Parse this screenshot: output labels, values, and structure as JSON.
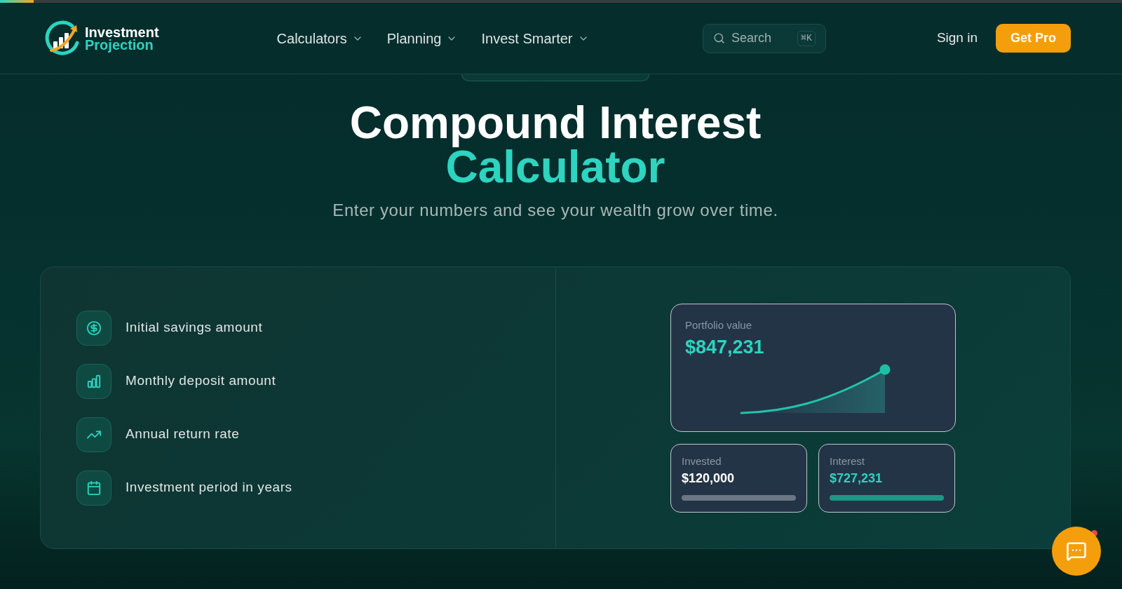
{
  "loading_bar": {
    "level": 0.03
  },
  "header": {
    "logo": {
      "line1": "Investment",
      "line2": "Projection"
    },
    "nav": [
      {
        "label": "Calculators"
      },
      {
        "label": "Planning"
      },
      {
        "label": "Invest Smarter"
      }
    ],
    "search": {
      "label": "Search",
      "shortcut": "⌘K"
    },
    "sign_in": "Sign in",
    "cta": "Get Pro"
  },
  "hero": {
    "title_line1": "Compound Interest",
    "title_line2": "Calculator",
    "subtitle": "Enter your numbers and see your wealth grow over time."
  },
  "calculator": {
    "fields": [
      {
        "label": "Initial savings amount",
        "kind": "dollar"
      },
      {
        "label": "Monthly deposit amount",
        "kind": "bars"
      },
      {
        "label": "Annual return rate",
        "kind": "trend"
      },
      {
        "label": "Investment period in years",
        "kind": "calendar"
      }
    ],
    "preview": {
      "portfolio": {
        "label": "Portfolio value",
        "value": "$847,231"
      },
      "stats": [
        {
          "label": "Invested",
          "value": "$120,000",
          "kind": "principal"
        },
        {
          "label": "Interest",
          "value": "$727,231",
          "kind": "interest"
        }
      ]
    }
  },
  "chat_button": {
    "unread": true
  }
}
